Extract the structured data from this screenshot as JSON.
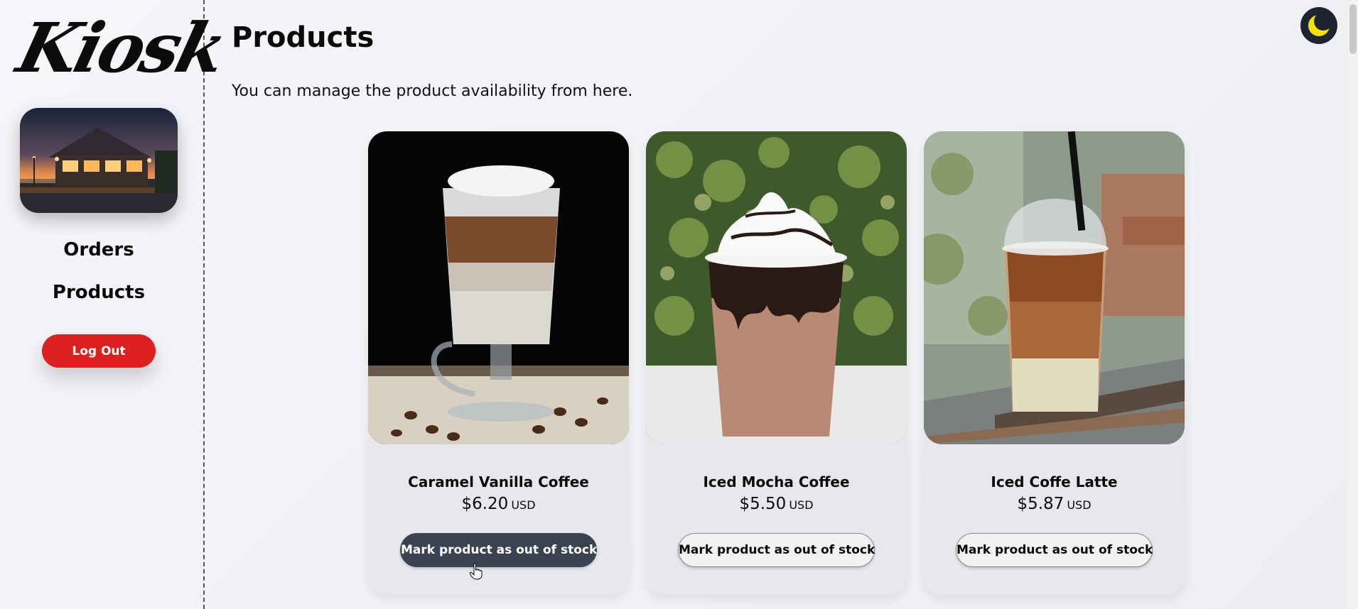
{
  "sidebar": {
    "logo_text": "Kiosk",
    "nav": [
      {
        "label": "Orders"
      },
      {
        "label": "Products"
      }
    ],
    "logout_label": "Log Out"
  },
  "main": {
    "title": "Products",
    "subtitle": "You can manage the product availability from here."
  },
  "products": [
    {
      "name": "Caramel Vanilla Coffee",
      "price": "$6.20",
      "currency": "USD",
      "action_label": "Mark product as out of stock",
      "hovered": true
    },
    {
      "name": "Iced Mocha Coffee",
      "price": "$5.50",
      "currency": "USD",
      "action_label": "Mark product as out of stock",
      "hovered": false
    },
    {
      "name": "Iced Coffe Latte",
      "price": "$5.87",
      "currency": "USD",
      "action_label": "Mark product as out of stock",
      "hovered": false
    }
  ],
  "theme_toggle": {
    "icon": "moon-icon"
  },
  "colors": {
    "accent_logout": "#dc2020",
    "button_hover": "#3a4352",
    "toggle_bg": "#1d2533",
    "moon": "#f5e400"
  }
}
